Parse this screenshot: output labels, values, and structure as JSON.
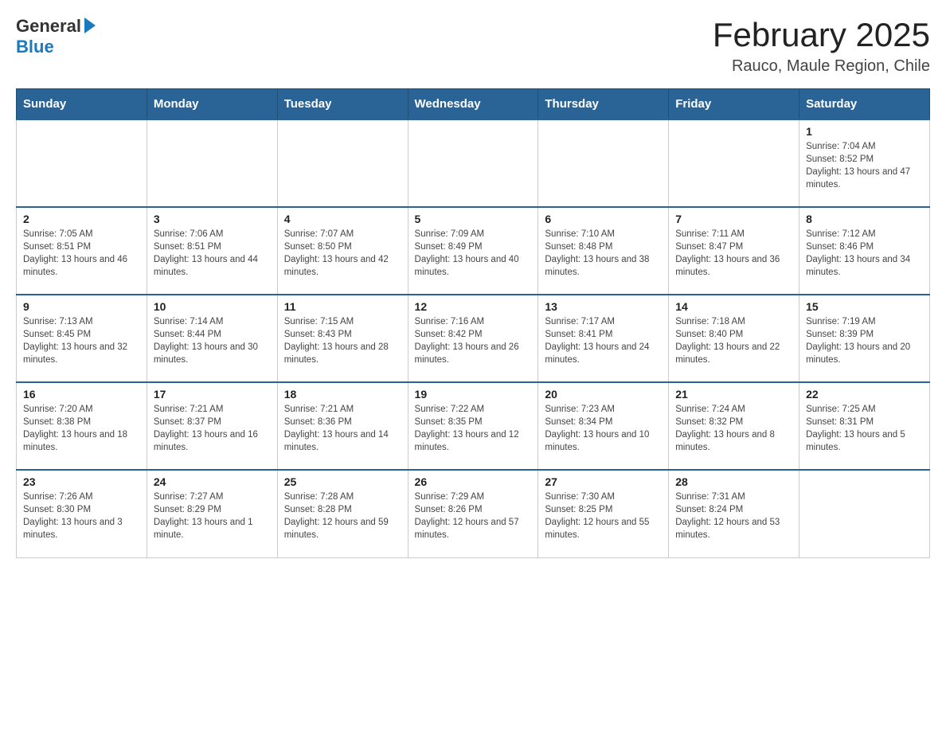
{
  "header": {
    "logo_general": "General",
    "logo_blue": "Blue",
    "month_title": "February 2025",
    "location": "Rauco, Maule Region, Chile"
  },
  "days_of_week": [
    "Sunday",
    "Monday",
    "Tuesday",
    "Wednesday",
    "Thursday",
    "Friday",
    "Saturday"
  ],
  "weeks": [
    [
      {
        "day": "",
        "info": ""
      },
      {
        "day": "",
        "info": ""
      },
      {
        "day": "",
        "info": ""
      },
      {
        "day": "",
        "info": ""
      },
      {
        "day": "",
        "info": ""
      },
      {
        "day": "",
        "info": ""
      },
      {
        "day": "1",
        "info": "Sunrise: 7:04 AM\nSunset: 8:52 PM\nDaylight: 13 hours and 47 minutes."
      }
    ],
    [
      {
        "day": "2",
        "info": "Sunrise: 7:05 AM\nSunset: 8:51 PM\nDaylight: 13 hours and 46 minutes."
      },
      {
        "day": "3",
        "info": "Sunrise: 7:06 AM\nSunset: 8:51 PM\nDaylight: 13 hours and 44 minutes."
      },
      {
        "day": "4",
        "info": "Sunrise: 7:07 AM\nSunset: 8:50 PM\nDaylight: 13 hours and 42 minutes."
      },
      {
        "day": "5",
        "info": "Sunrise: 7:09 AM\nSunset: 8:49 PM\nDaylight: 13 hours and 40 minutes."
      },
      {
        "day": "6",
        "info": "Sunrise: 7:10 AM\nSunset: 8:48 PM\nDaylight: 13 hours and 38 minutes."
      },
      {
        "day": "7",
        "info": "Sunrise: 7:11 AM\nSunset: 8:47 PM\nDaylight: 13 hours and 36 minutes."
      },
      {
        "day": "8",
        "info": "Sunrise: 7:12 AM\nSunset: 8:46 PM\nDaylight: 13 hours and 34 minutes."
      }
    ],
    [
      {
        "day": "9",
        "info": "Sunrise: 7:13 AM\nSunset: 8:45 PM\nDaylight: 13 hours and 32 minutes."
      },
      {
        "day": "10",
        "info": "Sunrise: 7:14 AM\nSunset: 8:44 PM\nDaylight: 13 hours and 30 minutes."
      },
      {
        "day": "11",
        "info": "Sunrise: 7:15 AM\nSunset: 8:43 PM\nDaylight: 13 hours and 28 minutes."
      },
      {
        "day": "12",
        "info": "Sunrise: 7:16 AM\nSunset: 8:42 PM\nDaylight: 13 hours and 26 minutes."
      },
      {
        "day": "13",
        "info": "Sunrise: 7:17 AM\nSunset: 8:41 PM\nDaylight: 13 hours and 24 minutes."
      },
      {
        "day": "14",
        "info": "Sunrise: 7:18 AM\nSunset: 8:40 PM\nDaylight: 13 hours and 22 minutes."
      },
      {
        "day": "15",
        "info": "Sunrise: 7:19 AM\nSunset: 8:39 PM\nDaylight: 13 hours and 20 minutes."
      }
    ],
    [
      {
        "day": "16",
        "info": "Sunrise: 7:20 AM\nSunset: 8:38 PM\nDaylight: 13 hours and 18 minutes."
      },
      {
        "day": "17",
        "info": "Sunrise: 7:21 AM\nSunset: 8:37 PM\nDaylight: 13 hours and 16 minutes."
      },
      {
        "day": "18",
        "info": "Sunrise: 7:21 AM\nSunset: 8:36 PM\nDaylight: 13 hours and 14 minutes."
      },
      {
        "day": "19",
        "info": "Sunrise: 7:22 AM\nSunset: 8:35 PM\nDaylight: 13 hours and 12 minutes."
      },
      {
        "day": "20",
        "info": "Sunrise: 7:23 AM\nSunset: 8:34 PM\nDaylight: 13 hours and 10 minutes."
      },
      {
        "day": "21",
        "info": "Sunrise: 7:24 AM\nSunset: 8:32 PM\nDaylight: 13 hours and 8 minutes."
      },
      {
        "day": "22",
        "info": "Sunrise: 7:25 AM\nSunset: 8:31 PM\nDaylight: 13 hours and 5 minutes."
      }
    ],
    [
      {
        "day": "23",
        "info": "Sunrise: 7:26 AM\nSunset: 8:30 PM\nDaylight: 13 hours and 3 minutes."
      },
      {
        "day": "24",
        "info": "Sunrise: 7:27 AM\nSunset: 8:29 PM\nDaylight: 13 hours and 1 minute."
      },
      {
        "day": "25",
        "info": "Sunrise: 7:28 AM\nSunset: 8:28 PM\nDaylight: 12 hours and 59 minutes."
      },
      {
        "day": "26",
        "info": "Sunrise: 7:29 AM\nSunset: 8:26 PM\nDaylight: 12 hours and 57 minutes."
      },
      {
        "day": "27",
        "info": "Sunrise: 7:30 AM\nSunset: 8:25 PM\nDaylight: 12 hours and 55 minutes."
      },
      {
        "day": "28",
        "info": "Sunrise: 7:31 AM\nSunset: 8:24 PM\nDaylight: 12 hours and 53 minutes."
      },
      {
        "day": "",
        "info": ""
      }
    ]
  ]
}
